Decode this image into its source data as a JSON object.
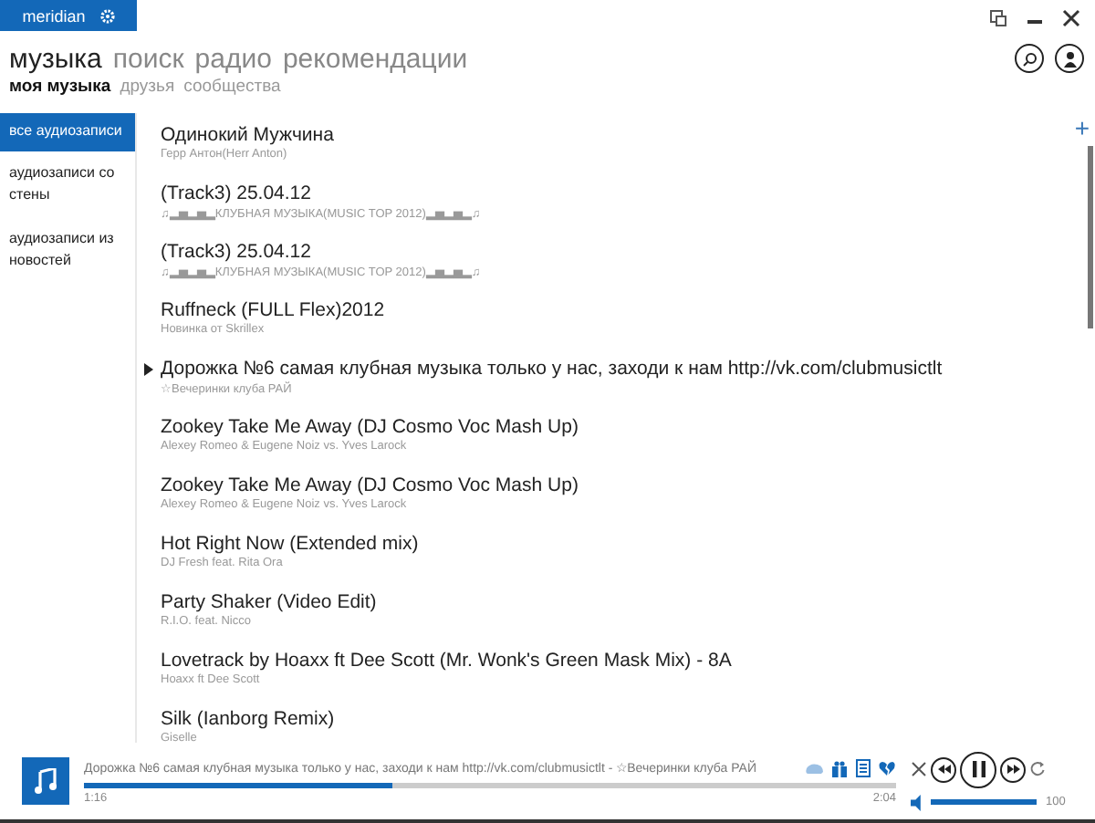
{
  "app": {
    "logo": "meridian"
  },
  "nav": [
    {
      "label": "музыка",
      "selected": true
    },
    {
      "label": "поиск",
      "selected": false
    },
    {
      "label": "радио",
      "selected": false
    },
    {
      "label": "рекомендации",
      "selected": false
    }
  ],
  "subnav": [
    {
      "label": "моя музыка",
      "selected": true
    },
    {
      "label": "друзья",
      "selected": false
    },
    {
      "label": "сообщества",
      "selected": false
    }
  ],
  "add_button": "+",
  "sidebar": {
    "items": [
      {
        "label": "все аудиозаписи",
        "selected": true
      },
      {
        "label": "аудиозаписи со стены",
        "selected": false
      },
      {
        "label": "аудиозаписи из новостей",
        "selected": false
      }
    ]
  },
  "tracks": [
    {
      "title": "Одинокий Мужчина",
      "artist": "Герр Антон(Herr Anton)",
      "playing": false
    },
    {
      "title": "(Track3) 25.04.12",
      "artist": "♫▂▅▂▅▂КЛУБНАЯ МУЗЫКА(MUSIC TOP 2012)▂▅▂▅▂♫",
      "playing": false
    },
    {
      "title": "(Track3) 25.04.12",
      "artist": "♫▂▅▂▅▂КЛУБНАЯ МУЗЫКА(MUSIC TOP 2012)▂▅▂▅▂♫",
      "playing": false
    },
    {
      "title": "Ruffneck (FULL Flex)2012",
      "artist": "Новинка от Skrillex",
      "playing": false
    },
    {
      "title": "Дорожка №6  самая клубная музыка только у нас, заходи к нам http://vk.com/clubmusictlt",
      "artist": "☆Вечеринки клуба РАЙ",
      "playing": true
    },
    {
      "title": "Zookey Take Me Away (DJ Cosmo Voc Mash Up)",
      "artist": "Alexey Romeo & Eugene Noiz vs. Yves Larock",
      "playing": false
    },
    {
      "title": "Zookey Take Me Away (DJ Cosmo Voc Mash Up)",
      "artist": "Alexey Romeo & Eugene Noiz vs. Yves Larock",
      "playing": false
    },
    {
      "title": "Hot Right Now (Extended mix)",
      "artist": "DJ Fresh feat. Rita Ora",
      "playing": false
    },
    {
      "title": "Party Shaker (Video Edit)",
      "artist": "R.I.O. feat. Nicco",
      "playing": false
    },
    {
      "title": "Lovetrack by Hoaxx ft Dee Scott (Mr. Wonk's Green Mask Mix) - 8A",
      "artist": "Hoaxx ft Dee Scott",
      "playing": false
    },
    {
      "title": "Silk (Ianborg Remix)",
      "artist": "Giselle",
      "playing": false
    }
  ],
  "player": {
    "now_playing": "Дорожка №6  самая клубная музыка только у нас, заходи к нам http://vk.com/clubmusictlt - ☆Вечеринки клуба РАЙ",
    "level": 0.38,
    "elapsed": "1:16",
    "duration": "2:04",
    "volume": {
      "level": 1,
      "reading": "100"
    }
  }
}
